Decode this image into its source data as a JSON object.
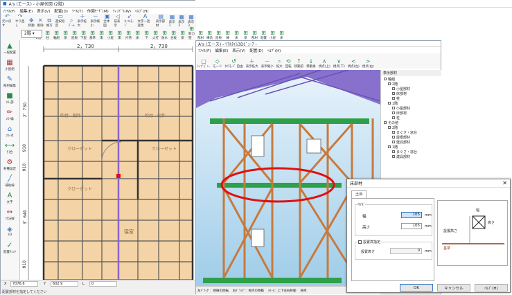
{
  "main": {
    "title": "A's (エース) - 小屋伏図 (2階)",
    "menu": [
      "ﾌｧｲﾙ(F)",
      "編集(E)",
      "表示(V)",
      "配置(D)",
      "ﾂｰﾙ(T)",
      "作図ﾓｰﾄﾞ(M)",
      "ｳｨﾝﾄﾞｳ(W)",
      "ﾍﾙﾌﾟ(H)"
    ],
    "toolbar": [
      "元に戻す",
      "やり直し",
      "移動",
      "削除",
      "複写",
      "選択指定",
      "ｽﾞｰﾑ",
      "表示拡大",
      "表示縮小",
      "全体図",
      "前表示",
      "ｶｰｿﾙﾓｰﾄﾞ",
      "文字一括変更",
      "表示部材",
      "表示1",
      "表示2",
      "表示3"
    ],
    "toolbar2": [
      "ﾒﾆｭｰ",
      "2階",
      "柱",
      "軸組",
      "梁",
      "屋根",
      "下屋",
      "基準",
      "束",
      "小屋",
      "束",
      "片持",
      "床",
      "下",
      "火打",
      "防水",
      "合板",
      "梁",
      "耐力壁",
      "部材",
      "構造",
      "屋根",
      "棟",
      "床",
      "梁",
      "部材",
      "配置",
      "小屋",
      "床"
    ],
    "sidebar": [
      "一般配置",
      "小屋組",
      "部材編集",
      "ﾌﾛｰ部",
      "ﾌﾛｰ編",
      "ﾌﾛｰ点",
      "引合",
      "各種設定",
      "補助線",
      "文字",
      "寸法線",
      "3D",
      "配置ﾁｪｯｸ"
    ],
    "dims_top": [
      "2，730",
      "2，730"
    ],
    "dims_left": [
      "2，730",
      "910",
      "910",
      "3，640",
      "910"
    ],
    "rooms": [
      "吹付　創作",
      "吹付　創作",
      "クローゼット",
      "クローゼット",
      "クローゼット",
      "寝室"
    ],
    "status": {
      "x_label": "X",
      "x": "7076.6",
      "y_label": "Y",
      "y": "602.9",
      "l_label": "L",
      "l": "0"
    },
    "floor_label": "2階",
    "hint": "配置部材を指定してください"
  },
  "viewer": {
    "title": "A's (エース) - ﾘｱﾙﾀｲﾑ3Dﾋﾞｭｰｱ -",
    "menu": [
      "ﾌｧｲﾙ(F)",
      "編集(E)",
      "表示(V)",
      "配置(D)",
      "ﾍﾙﾌﾟ(H)"
    ],
    "toolbar": [
      "ﾄｯﾌﾟﾋﾞｭｰ",
      "モード",
      "ｶﾒﾗﾓｰﾄﾞ 自由",
      "表示拡大",
      "表示縮小",
      "拡大",
      "回転",
      "移動前",
      "移動後",
      "視点(上)",
      "視点(下)",
      "視点(左)",
      "視点(右)"
    ],
    "panel_title": "表示部材",
    "tree": [
      "軸組",
      "2階",
      "小屋部材",
      "床部材",
      "柱",
      "1階",
      "小屋部材",
      "床部材",
      "柱",
      "その他",
      "2階",
      "まぐさ・窓台",
      "屋根部材",
      "建具部材",
      "1階",
      "まぐさ・窓台",
      "建具部材"
    ],
    "status": [
      "左ﾄﾞﾗｯｸﾞ：視線の回転",
      "右ﾄﾞﾗｯｸﾞ：視点の移動",
      "ﾎｲｰﾙ：上下左右移動",
      "倍率"
    ]
  },
  "dialog": {
    "title": "床部材",
    "tab": "土台",
    "size_label": "ｻｲｽﾞ",
    "w_label": "幅",
    "w_val": "105",
    "h_label": "高さ",
    "h_val": "105",
    "unit": "mm",
    "checkbox_label": "設置高指定",
    "set_label": "設置高さ",
    "set_val": "0",
    "diagram": {
      "w": "幅",
      "h": "高さ",
      "set": "設置高さ",
      "base": "基準"
    },
    "ok": "OK",
    "cancel": "キャンセル",
    "help": "ﾍﾙﾌﾟ(H)"
  },
  "colors": {
    "accent": "#3a78c2",
    "beam": "#c67a3d",
    "green": "#2fa04a",
    "purple": "#8a63c9",
    "red": "#e01010"
  }
}
